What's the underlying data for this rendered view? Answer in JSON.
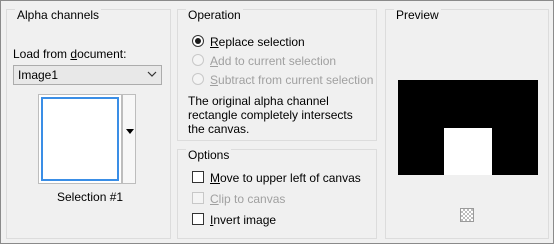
{
  "alpha_channels": {
    "title": "Alpha channels",
    "load_label": "Load from ",
    "load_label_accel": "d",
    "load_label_rest": "ocument:",
    "document_value": "Image1",
    "selection_caption": "Selection #1"
  },
  "operation": {
    "title": "Operation",
    "options": [
      {
        "accel": "R",
        "rest": "eplace selection",
        "checked": true,
        "enabled": true
      },
      {
        "accel": "A",
        "rest": "dd to current selection",
        "checked": false,
        "enabled": false
      },
      {
        "accel": "S",
        "rest": "ubtract from current selection",
        "checked": false,
        "enabled": false
      }
    ],
    "note": "The original alpha channel rectangle completely intersects the canvas."
  },
  "options": {
    "title": "Options",
    "items": [
      {
        "accel": "M",
        "rest": "ove to upper left of canvas",
        "checked": false,
        "enabled": true
      },
      {
        "accel": "C",
        "rest": "lip to canvas",
        "checked": false,
        "enabled": false
      },
      {
        "accel": "I",
        "rest": "nvert image",
        "checked": false,
        "enabled": true
      }
    ]
  },
  "preview": {
    "title": "Preview"
  },
  "icons": {
    "dropdown": "chevron-down-icon",
    "thumb_dropdown": "triangle-down-icon",
    "transparency": "checkerboard-icon"
  }
}
